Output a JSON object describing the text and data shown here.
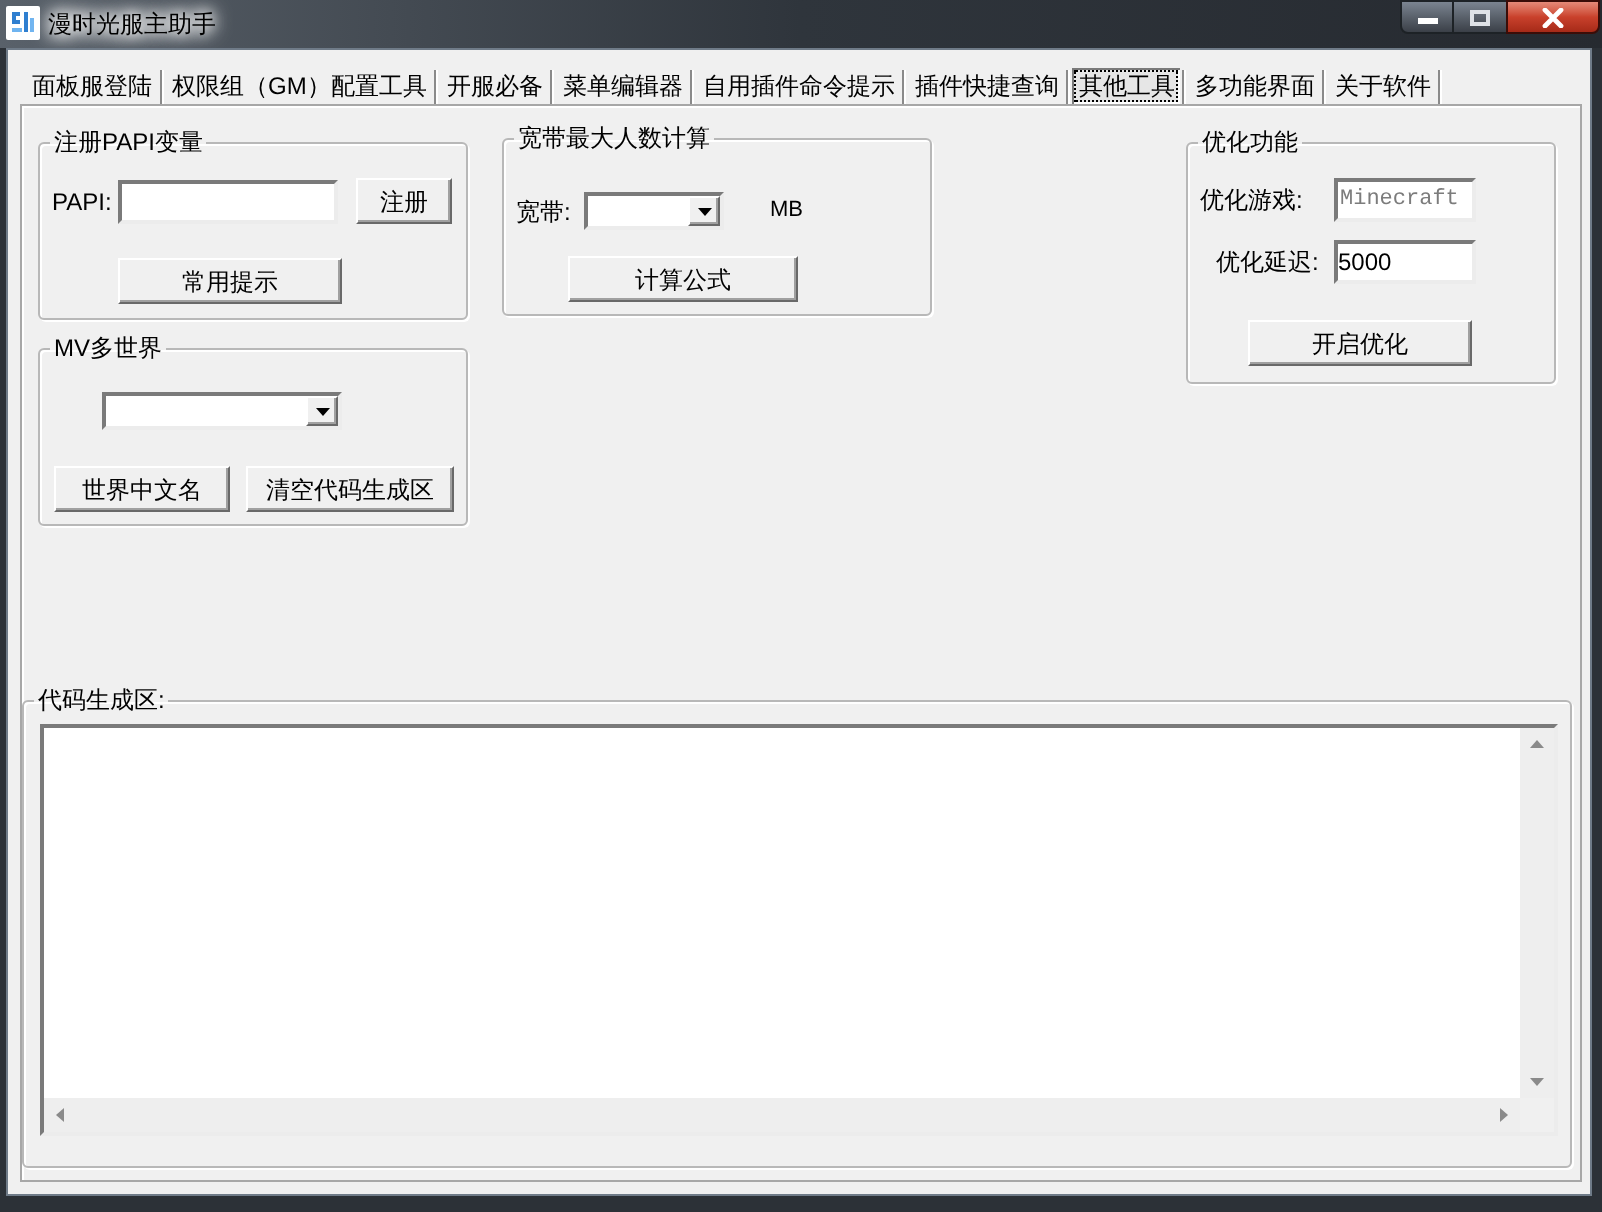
{
  "window": {
    "title": "漫时光服主助手"
  },
  "tabs": [
    {
      "label": "面板服登陆",
      "selected": false
    },
    {
      "label": "权限组（GM）配置工具",
      "selected": false
    },
    {
      "label": "开服必备",
      "selected": false
    },
    {
      "label": "菜单编辑器",
      "selected": false
    },
    {
      "label": "自用插件命令提示",
      "selected": false
    },
    {
      "label": "插件快捷查询",
      "selected": false
    },
    {
      "label": "其他工具",
      "selected": true
    },
    {
      "label": "多功能界面",
      "selected": false
    },
    {
      "label": "关于软件",
      "selected": false
    }
  ],
  "papi_group": {
    "title": "注册PAPI变量",
    "field_label": "PAPI:",
    "register_button": "注册",
    "hints_button": "常用提示"
  },
  "bandwidth_group": {
    "title": "宽带最大人数计算",
    "field_label": "宽带:",
    "unit": "MB",
    "formula_button": "计算公式"
  },
  "mv_group": {
    "title": "MV多世界",
    "buttons": [
      "世界中文名",
      "清空代码生成区"
    ]
  },
  "optimize_group": {
    "title": "优化功能",
    "fields": [
      {
        "label": "优化游戏:",
        "value": "Minecraft",
        "disabled": true
      },
      {
        "label": "优化延迟:",
        "value": "5000",
        "disabled": false
      }
    ],
    "button": "开启优化"
  },
  "code_area": {
    "title": "代码生成区:"
  }
}
